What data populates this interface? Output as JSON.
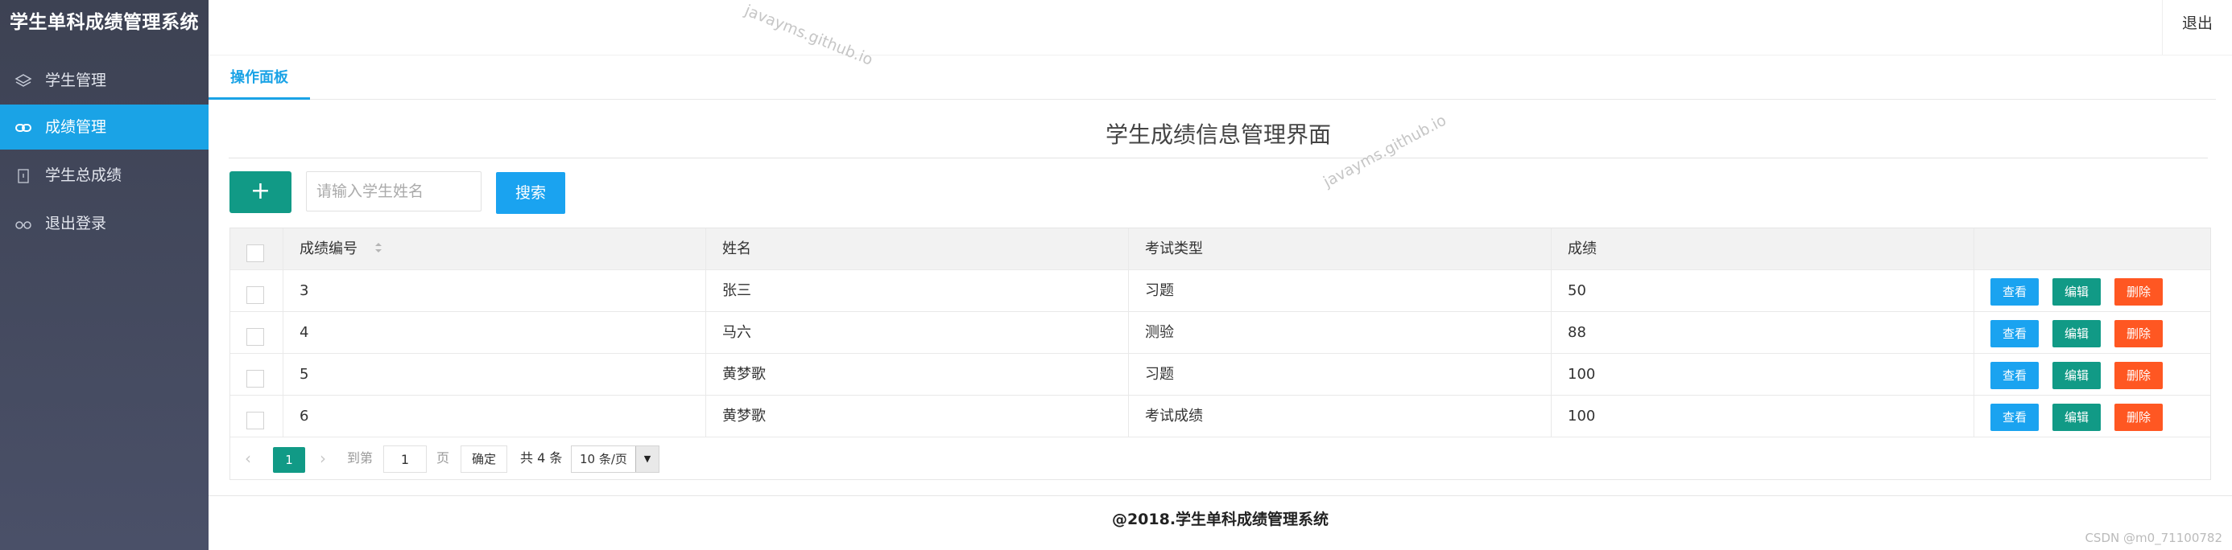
{
  "app": {
    "title": "学生单科成绩管理系统"
  },
  "sidebar": {
    "items": [
      {
        "label": "学生管理",
        "icon": "layers-icon",
        "active": false
      },
      {
        "label": "成绩管理",
        "icon": "link-icon",
        "active": true
      },
      {
        "label": "学生总成绩",
        "icon": "document-icon",
        "active": false
      },
      {
        "label": "退出登录",
        "icon": "glasses-icon",
        "active": false
      }
    ]
  },
  "header": {
    "logout_label": "退出"
  },
  "tabs": [
    {
      "label": "操作面板",
      "active": true
    }
  ],
  "main": {
    "page_title": "学生成绩信息管理界面",
    "add_label": "+",
    "search_placeholder": "请输入学生姓名",
    "search_label": "搜索"
  },
  "table": {
    "columns": [
      "成绩编号",
      "姓名",
      "考试类型",
      "成绩"
    ],
    "rows": [
      {
        "id": "3",
        "name": "张三",
        "type": "习题",
        "score": "50"
      },
      {
        "id": "4",
        "name": "马六",
        "type": "测验",
        "score": "88"
      },
      {
        "id": "5",
        "name": "黄梦歌",
        "type": "习题",
        "score": "100"
      },
      {
        "id": "6",
        "name": "黄梦歌",
        "type": "考试成绩",
        "score": "100"
      }
    ],
    "actions": {
      "view": "查看",
      "edit": "编辑",
      "delete": "删除"
    }
  },
  "pagination": {
    "current_page": "1",
    "goto_label": "到第",
    "goto_value": "1",
    "page_label": "页",
    "confirm_label": "确定",
    "total_label": "共 4 条",
    "page_size_label": "10 条/页"
  },
  "footer": {
    "text": "@2018.学生单科成绩管理系统"
  },
  "watermarks": {
    "site": "javayms.github.io",
    "csdn": "CSDN @m0_71100782"
  },
  "colors": {
    "sidebar_bg": "#434a5e",
    "accent_blue": "#1aa3f0",
    "accent_green": "#119a86",
    "danger_orange": "#ff5722"
  }
}
